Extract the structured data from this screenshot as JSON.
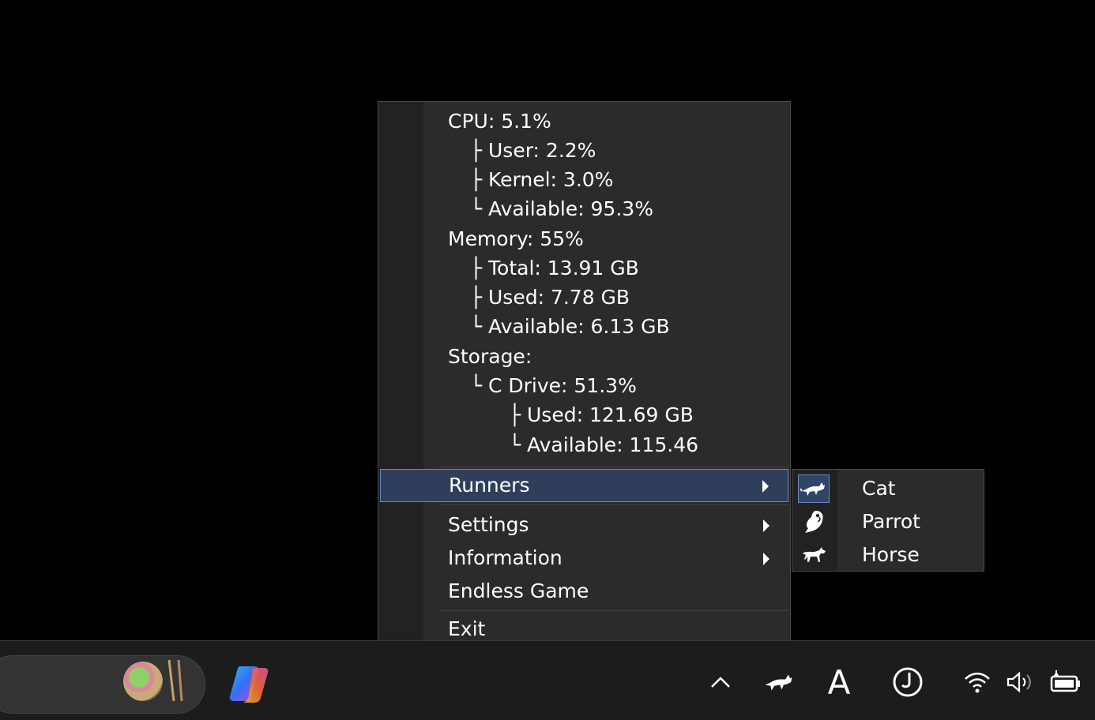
{
  "stats": [
    {
      "text": "CPU: 5.1%"
    },
    {
      "text": "├ User: 2.2%"
    },
    {
      "text": "├ Kernel: 3.0%"
    },
    {
      "text": "└ Available: 95.3%"
    },
    {
      "text": "Memory: 55%"
    },
    {
      "text": "├ Total: 13.91 GB"
    },
    {
      "text": "├ Used: 7.78 GB"
    },
    {
      "text": "└ Available: 6.13 GB"
    },
    {
      "text": "Storage:"
    },
    {
      "text": "└ C Drive: 51.3%"
    },
    {
      "text": "├ Used: 121.69 GB"
    },
    {
      "text": "└ Available: 115.46"
    }
  ],
  "menu": {
    "runners": "Runners",
    "settings": "Settings",
    "information": "Information",
    "endless_game": "Endless Game",
    "exit": "Exit"
  },
  "submenu": {
    "items": [
      {
        "label": "Cat",
        "icon": "cat-icon",
        "checked": true
      },
      {
        "label": "Parrot",
        "icon": "parrot-icon",
        "checked": false
      },
      {
        "label": "Horse",
        "icon": "horse-icon",
        "checked": false
      }
    ]
  },
  "taskbar": {
    "tray_font_letter": "A",
    "icons": [
      "search-pill",
      "copilot-icon",
      "chevron-up-icon",
      "runner-cat-icon",
      "font-icon",
      "clock-icon",
      "wifi-icon",
      "volume-icon",
      "battery-icon"
    ]
  },
  "colors": {
    "menu_bg": "#2b2b2b",
    "highlight_bg": "#2f3f5b",
    "highlight_border": "#6e87b8",
    "taskbar_bg": "#1c1c1c"
  }
}
